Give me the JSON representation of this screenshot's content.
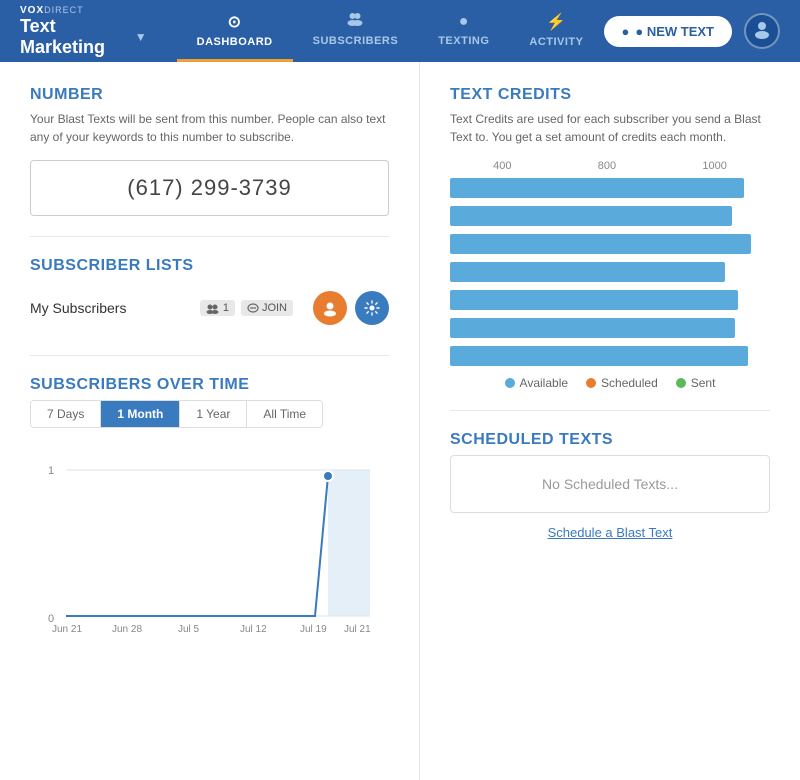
{
  "brand": {
    "vox": "VOX",
    "direct": "DIRECT",
    "title": "Text Marketing",
    "arrow": "▼"
  },
  "nav": {
    "tabs": [
      {
        "id": "dashboard",
        "label": "DASHBOARD",
        "icon": "⊙",
        "active": true
      },
      {
        "id": "subscribers",
        "label": "SUBSCRIBERS",
        "icon": "👤",
        "active": false
      },
      {
        "id": "texting",
        "label": "TEXTING",
        "icon": "●",
        "active": false
      },
      {
        "id": "activity",
        "label": "ACTIVITY",
        "icon": "⚡",
        "active": false
      }
    ]
  },
  "header_actions": {
    "new_text_label": "● NEW TEXT"
  },
  "number_section": {
    "title": "NUMBER",
    "desc": "Your Blast Texts will be sent from this number. People can also text any of your keywords to this number to subscribe.",
    "phone": "(617) 299-3739"
  },
  "subscriber_lists": {
    "title": "SUBSCRIBER LISTS",
    "list_name": "My Subscribers",
    "count_badge": "👥 1",
    "join_badge": "🔑 JOIN"
  },
  "subscribers_over_time": {
    "title": "SUBSCRIBERS OVER TIME",
    "filters": [
      "7 Days",
      "1 Month",
      "1 Year",
      "All Time"
    ],
    "active_filter": "1 Month",
    "y_max": 1,
    "y_min": 0,
    "x_labels": [
      "Jun 21",
      "Jun 28",
      "Jul 5",
      "Jul 12",
      "Jul 19",
      "Jul 21"
    ]
  },
  "text_credits": {
    "title": "TEXT CREDITS",
    "desc": "Text Credits are used for each subscriber you send a Blast Text to. You get a set amount of credits each month.",
    "scale_labels": [
      "400",
      "800",
      "1000"
    ],
    "bars": [
      {
        "width_pct": 92
      },
      {
        "width_pct": 88
      },
      {
        "width_pct": 94
      },
      {
        "width_pct": 86
      },
      {
        "width_pct": 90
      },
      {
        "width_pct": 89
      },
      {
        "width_pct": 93
      }
    ],
    "legend": [
      {
        "label": "Available",
        "color_class": "dot-blue"
      },
      {
        "label": "Scheduled",
        "color_class": "dot-orange"
      },
      {
        "label": "Sent",
        "color_class": "dot-green"
      }
    ]
  },
  "scheduled_texts": {
    "title": "SCHEDULED TEXTS",
    "empty_label": "No Scheduled Texts...",
    "schedule_link": "Schedule a Blast Text"
  }
}
